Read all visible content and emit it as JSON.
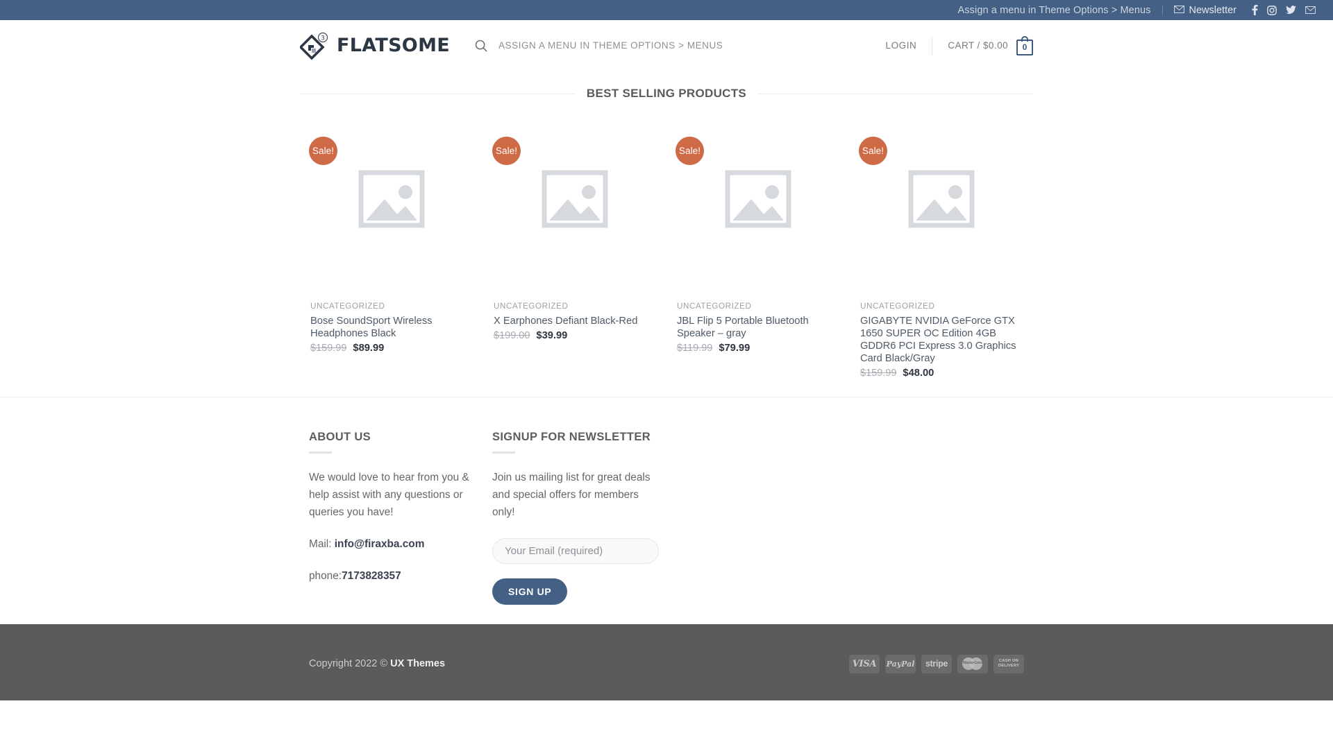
{
  "topbar": {
    "menu_notice": "Assign a menu in Theme Options > Menus",
    "newsletter_label": "Newsletter",
    "newsletter_icon": "envelope-icon",
    "social": [
      {
        "name": "facebook-icon",
        "label": "Facebook"
      },
      {
        "name": "instagram-icon",
        "label": "Instagram"
      },
      {
        "name": "twitter-icon",
        "label": "Twitter"
      },
      {
        "name": "email-icon",
        "label": "Email"
      }
    ]
  },
  "header": {
    "logo_text": "FLATSOME",
    "logo_badge": "3",
    "search_icon": "search-icon",
    "nav_notice": "ASSIGN A MENU IN THEME OPTIONS > MENUS",
    "login_label": "LOGIN",
    "cart_label": "CART / $0.00",
    "cart_count": "0"
  },
  "main": {
    "section_title": "BEST SELLING PRODUCTS",
    "products": [
      {
        "badge": "Sale!",
        "category": "UNCATEGORIZED",
        "name": "Bose SoundSport Wireless Headphones Black",
        "price_old": "$159.99",
        "price_new": "$89.99",
        "image": "placeholder-image-icon"
      },
      {
        "badge": "Sale!",
        "category": "UNCATEGORIZED",
        "name": "X Earphones Defiant Black-Red",
        "price_old": "$199.00",
        "price_new": "$39.99",
        "image": "placeholder-image-icon"
      },
      {
        "badge": "Sale!",
        "category": "UNCATEGORIZED",
        "name": "JBL Flip 5 Portable Bluetooth Speaker – gray",
        "price_old": "$119.99",
        "price_new": "$79.99",
        "image": "placeholder-image-icon"
      },
      {
        "badge": "Sale!",
        "category": "UNCATEGORIZED",
        "name": "GIGABYTE NVIDIA GeForce GTX 1650 SUPER OC Edition 4GB GDDR6 PCI Express 3.0 Graphics Card Black/Gray",
        "price_old": "$159.99",
        "price_new": "$48.00",
        "image": "placeholder-image-icon"
      }
    ]
  },
  "footer": {
    "about": {
      "title": "ABOUT US",
      "body": "We would love to hear from you & help assist with any questions or queries you have!",
      "mail_label": "Mail: ",
      "mail_value": "info@firaxba.com",
      "phone_label": "phone:",
      "phone_value": "7173828357"
    },
    "newsletter": {
      "title": "SIGNUP FOR NEWSLETTER",
      "body": "Join us mailing list for great deals and special offers for members only!",
      "email_placeholder": "Your Email (required)",
      "email_value": "",
      "button_label": "SIGN UP"
    }
  },
  "bottombar": {
    "copyright_prefix": "Copyright 2022 © ",
    "copyright_brand": "UX Themes",
    "payments": [
      {
        "name": "visa-icon",
        "label": "VISA"
      },
      {
        "name": "paypal-icon",
        "label": "PayPal"
      },
      {
        "name": "stripe-icon",
        "label": "stripe"
      },
      {
        "name": "mastercard-icon",
        "label": "MasterCard"
      },
      {
        "name": "cash-on-delivery-icon",
        "label": "CASH ON DELIVERY"
      }
    ]
  },
  "colors": {
    "topbar_bg": "#446084",
    "accent": "#446084",
    "sale_badge": "#cf6a47",
    "bottombar_bg": "#5b5b5b"
  }
}
